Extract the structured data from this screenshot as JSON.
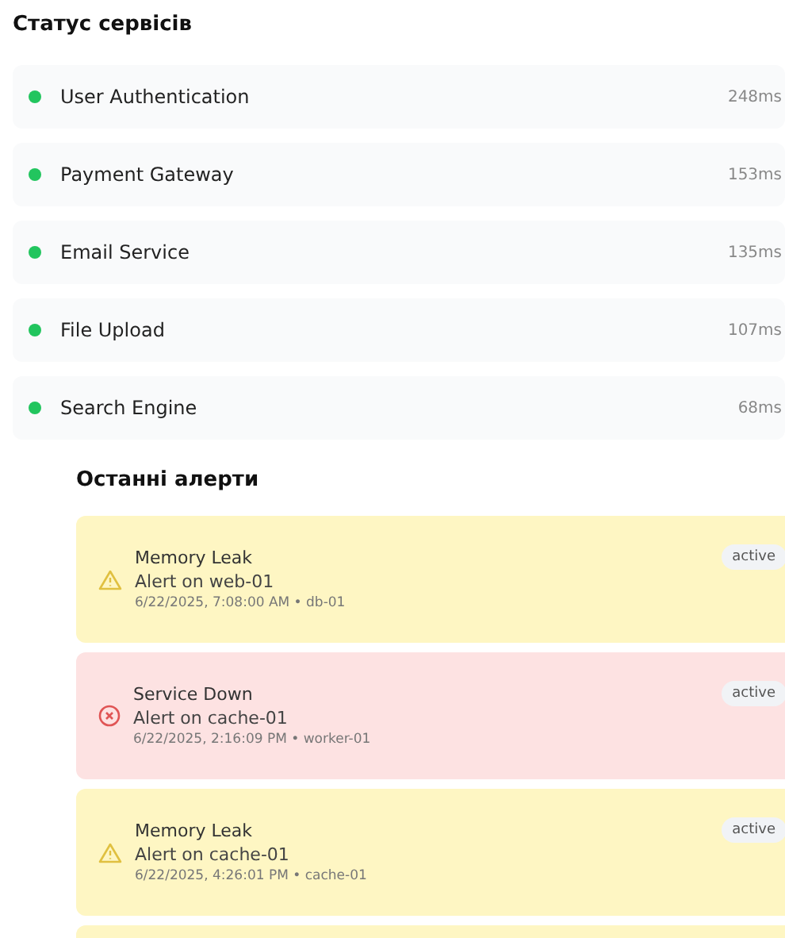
{
  "services_title": "Статус сервісів",
  "services": [
    {
      "name": "User Authentication",
      "latency": "248ms",
      "color": "#22c55e"
    },
    {
      "name": "Payment Gateway",
      "latency": "153ms",
      "color": "#22c55e"
    },
    {
      "name": "Email Service",
      "latency": "135ms",
      "color": "#22c55e"
    },
    {
      "name": "File Upload",
      "latency": "107ms",
      "color": "#22c55e"
    },
    {
      "name": "Search Engine",
      "latency": "68ms",
      "color": "#22c55e"
    }
  ],
  "alerts_title": "Останні алерти",
  "alerts": [
    {
      "kind": "warning",
      "title": "Memory Leak",
      "message": "Alert on web-01",
      "meta": "6/22/2025, 7:08:00 AM • db-01",
      "status": "active"
    },
    {
      "kind": "error",
      "title": "Service Down",
      "message": "Alert on cache-01",
      "meta": "6/22/2025, 2:16:09 PM • worker-01",
      "status": "active"
    },
    {
      "kind": "warning",
      "title": "Memory Leak",
      "message": "Alert on cache-01",
      "meta": "6/22/2025, 4:26:01 PM • cache-01",
      "status": "active"
    },
    {
      "kind": "warning"
    }
  ]
}
